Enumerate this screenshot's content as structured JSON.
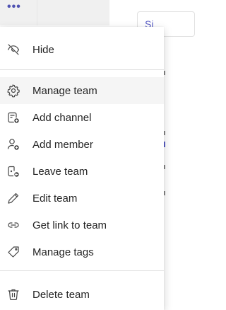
{
  "background": {
    "more_icon": "more-horizontal-icon",
    "tab_label": "Si"
  },
  "menu": {
    "items": [
      {
        "label": "Hide",
        "icon": "hide-icon"
      },
      {
        "label": "Manage team",
        "icon": "gear-icon"
      },
      {
        "label": "Add channel",
        "icon": "add-channel-icon"
      },
      {
        "label": "Add member",
        "icon": "add-member-icon"
      },
      {
        "label": "Leave team",
        "icon": "leave-team-icon"
      },
      {
        "label": "Edit team",
        "icon": "pencil-icon"
      },
      {
        "label": "Get link to team",
        "icon": "link-icon"
      },
      {
        "label": "Manage tags",
        "icon": "tag-icon"
      },
      {
        "label": "Delete team",
        "icon": "trash-icon"
      }
    ]
  }
}
